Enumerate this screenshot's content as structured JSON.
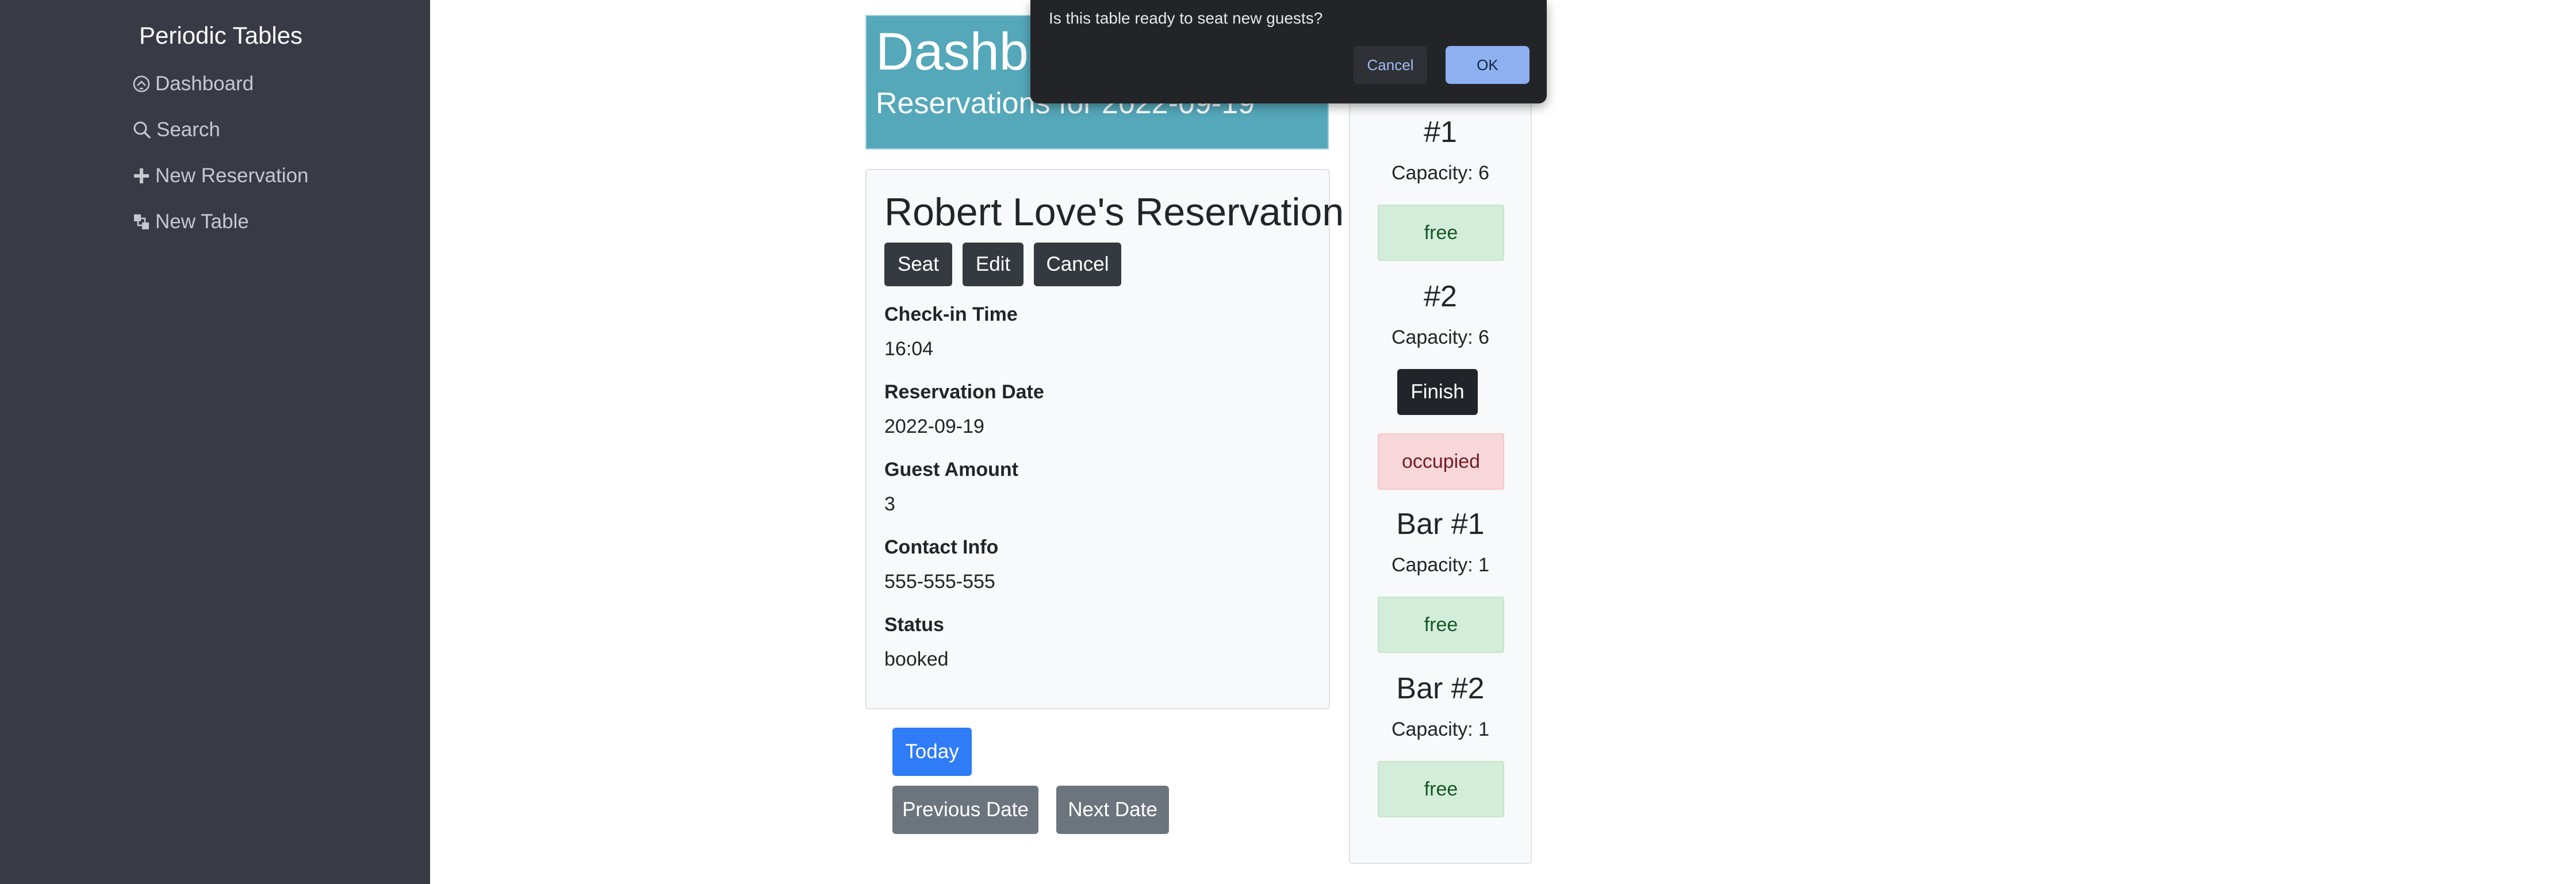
{
  "sidebar": {
    "brand": "Periodic Tables",
    "items": [
      {
        "label": "Dashboard",
        "icon": "dashboard-icon"
      },
      {
        "label": "Search",
        "icon": "search-icon"
      },
      {
        "label": "New Reservation",
        "icon": "plus-icon"
      },
      {
        "label": "New Table",
        "icon": "layers-icon"
      }
    ]
  },
  "header": {
    "title": "Dashboard",
    "subtitle": "Reservations for 2022-09-19"
  },
  "reservation": {
    "title": "Robert Love's Reservation",
    "buttons": {
      "seat": "Seat",
      "edit": "Edit",
      "cancel": "Cancel"
    },
    "fields": [
      {
        "label": "Check-in Time",
        "value": "16:04"
      },
      {
        "label": "Reservation Date",
        "value": "2022-09-19"
      },
      {
        "label": "Guest Amount",
        "value": "3"
      },
      {
        "label": "Contact Info",
        "value": "555-555-555"
      },
      {
        "label": "Status",
        "value": "booked"
      }
    ]
  },
  "date_nav": {
    "today": "Today",
    "previous": "Previous Date",
    "next": "Next Date"
  },
  "tables": [
    {
      "name": "#1",
      "capacity": "Capacity: 6",
      "status": "free"
    },
    {
      "name": "#2",
      "capacity": "Capacity: 6",
      "status": "occupied",
      "finish": "Finish"
    },
    {
      "name": "Bar #1",
      "capacity": "Capacity: 1",
      "status": "free"
    },
    {
      "name": "Bar #2",
      "capacity": "Capacity: 1",
      "status": "free"
    }
  ],
  "dialog": {
    "message": "Is this table ready to seat new guests?",
    "cancel": "Cancel",
    "ok": "OK"
  },
  "colors": {
    "sidebar_bg": "#3a3a46",
    "header_bg": "#54a8ba",
    "free_bg": "#d4edda",
    "occupied_bg": "#f8d7da",
    "primary": "#2f7cf6",
    "dialog_bg": "#232428"
  }
}
